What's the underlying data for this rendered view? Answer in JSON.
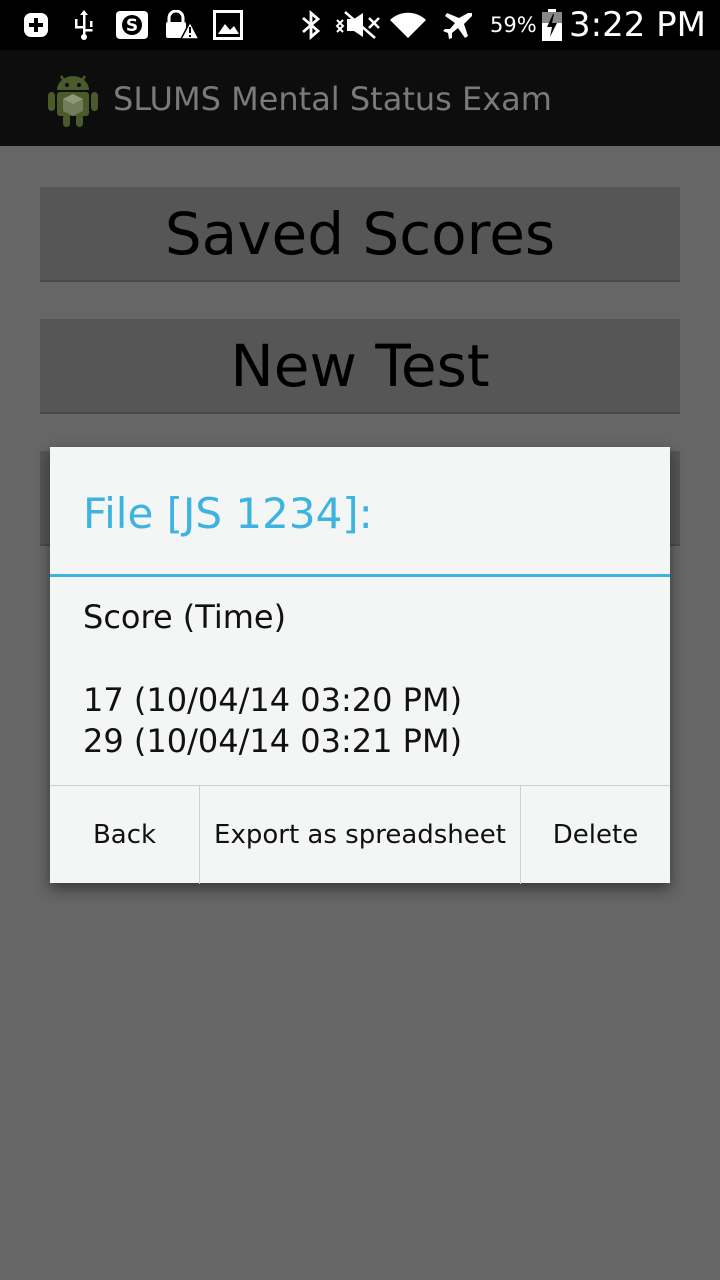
{
  "status_bar": {
    "icons": [
      "add-icon",
      "usb-icon",
      "s-app-icon",
      "lock-warning-icon",
      "image-icon",
      "bluetooth-icon",
      "mute-icon",
      "wifi-icon",
      "airplane-icon",
      "battery-charging-icon"
    ],
    "battery_percent": "59%",
    "time": "3:22 PM"
  },
  "action_bar": {
    "title": "SLUMS Mental Status Exam",
    "icon": "android-app-icon"
  },
  "main": {
    "saved_scores_label": "Saved Scores",
    "new_test_label": "New Test"
  },
  "dialog": {
    "title": "File [JS 1234]:",
    "header": "Score (Time)",
    "entries": [
      "17 (10/04/14 03:20 PM)",
      "29 (10/04/14 03:21 PM)"
    ],
    "buttons": {
      "back": "Back",
      "export": "Export as spreadsheet",
      "delete": "Delete"
    }
  },
  "colors": {
    "accent": "#3db3e0",
    "dim_background": "#666666",
    "dialog_background": "#f4f5f5"
  }
}
